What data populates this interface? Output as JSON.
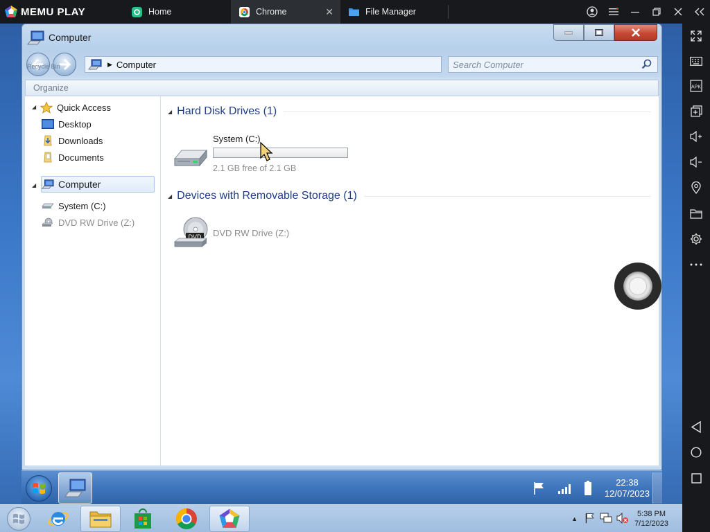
{
  "emulator": {
    "brand": "MEMU PLAY",
    "tabs": [
      {
        "label": "Home",
        "icon": "home-app-icon"
      },
      {
        "label": "Chrome",
        "icon": "chrome-icon",
        "active": true
      },
      {
        "label": "File Manager",
        "icon": "folder-icon"
      }
    ],
    "controls": [
      "account-icon",
      "menu-icon",
      "minimize-icon",
      "restore-icon",
      "close-icon",
      "collapse-sidebar-icon"
    ],
    "sidebar": [
      "fullscreen-icon",
      "keyboard-icon",
      "apk-icon",
      "add-window-icon",
      "volume-up-icon",
      "volume-down-icon",
      "location-icon",
      "folder-icon",
      "settings-icon",
      "more-icon",
      "back-icon",
      "home-icon",
      "recents-icon"
    ],
    "sidebar_apk_label": "APK",
    "accent": "#2c2f34"
  },
  "explorer": {
    "title": "Computer",
    "recycle_bin_ghost": "Recycle Bin",
    "address": "Computer",
    "search_placeholder": "Search Computer",
    "organize": "Organize",
    "nav": {
      "quick_access": "Quick Access",
      "desktop": "Desktop",
      "downloads": "Downloads",
      "documents": "Documents",
      "computer": "Computer",
      "system_c": "System (C:)",
      "dvd": "DVD RW Drive (Z:)"
    },
    "groups": {
      "hdd": "Hard Disk Drives (1)",
      "removable": "Devices with Removable Storage (1)"
    },
    "drives": {
      "c_label": "System (C:)",
      "c_free": "2.1 GB free of 2.1 GB",
      "c_used_fraction": 0.0,
      "dvd_label": "DVD RW Drive (Z:)",
      "dvd_badge": "DVD"
    }
  },
  "inner_taskbar": {
    "time": "22:38",
    "date": "12/07/2023"
  },
  "outer_taskbar": {
    "time": "5:38 PM",
    "date": "7/12/2023",
    "pins": [
      "internet-explorer-icon",
      "file-explorer-icon",
      "store-icon",
      "chrome-icon",
      "memu-icon"
    ]
  }
}
